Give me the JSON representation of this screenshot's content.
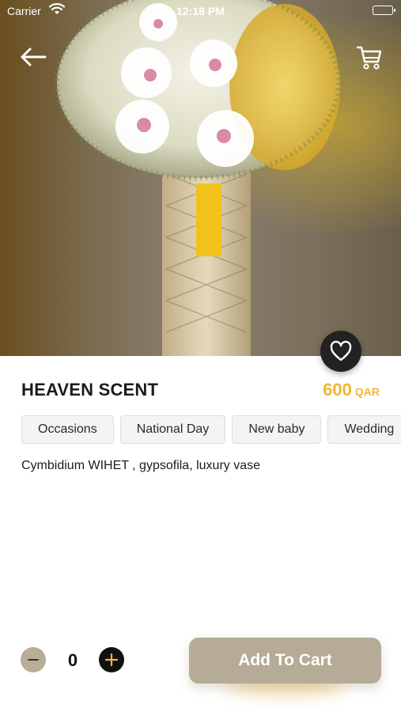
{
  "status_bar": {
    "carrier": "Carrier",
    "time": "12:18 PM"
  },
  "header": {
    "back_icon": "arrow-left-icon",
    "cart_icon": "shopping-cart-icon"
  },
  "product": {
    "name": "HEAVEN SCENT",
    "price": "600",
    "currency": "QAR",
    "description": "Cymbidium WIHET , gypsofila, luxury vase",
    "favorite_icon": "heart-icon",
    "tags": [
      "Occasions",
      "National Day",
      "New baby",
      "Wedding"
    ]
  },
  "cart_controls": {
    "quantity": "0",
    "minus_icon": "minus-icon",
    "plus_icon": "plus-icon",
    "add_label": "Add To Cart"
  },
  "colors": {
    "accent_price": "#f2b632",
    "button_bg": "#b5ab96",
    "dark": "#222222"
  }
}
